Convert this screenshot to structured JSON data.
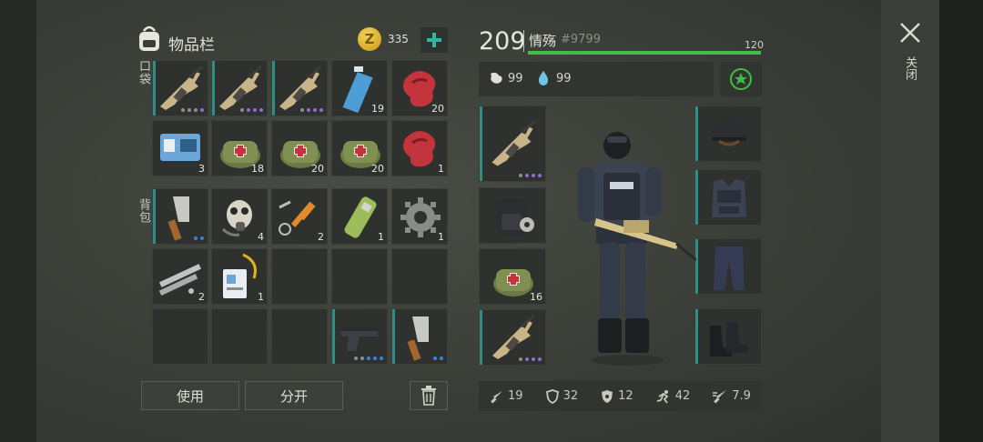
{
  "inventory": {
    "title": "物品栏",
    "coins": "335",
    "pocket_label": "口袋",
    "backpack_label": "背包",
    "slots": [
      {
        "icon": "rifle-icon",
        "count": "",
        "dots": "gggp"
      },
      {
        "icon": "rifle-icon",
        "count": "",
        "dots": "gppp"
      },
      {
        "icon": "rifle-icon",
        "count": "",
        "dots": "gppp"
      },
      {
        "icon": "water-bottle-icon",
        "count": "19",
        "dots": ""
      },
      {
        "icon": "raw-meat-icon",
        "count": "20",
        "dots": ""
      },
      {
        "icon": "keycard-icon",
        "count": "3",
        "dots": ""
      },
      {
        "icon": "medkit-bag-icon",
        "count": "18",
        "dots": ""
      },
      {
        "icon": "medkit-bag-icon",
        "count": "20",
        "dots": ""
      },
      {
        "icon": "medkit-bag-icon",
        "count": "20",
        "dots": ""
      },
      {
        "icon": "raw-meat-icon",
        "count": "1",
        "dots": ""
      },
      {
        "icon": "cleaver-icon",
        "count": "",
        "dots": "bb"
      },
      {
        "icon": "gas-mask-icon",
        "count": "4",
        "dots": ""
      },
      {
        "icon": "weapon-parts-icon",
        "count": "2",
        "dots": ""
      },
      {
        "icon": "battery-canister-icon",
        "count": "1",
        "dots": ""
      },
      {
        "icon": "gear-icon",
        "count": "1",
        "dots": ""
      },
      {
        "icon": "metal-pipes-icon",
        "count": "2",
        "dots": ""
      },
      {
        "icon": "id-badge-icon",
        "count": "1",
        "dots": ""
      },
      {
        "icon": "",
        "count": "",
        "dots": ""
      },
      {
        "icon": "",
        "count": "",
        "dots": ""
      },
      {
        "icon": "",
        "count": "",
        "dots": ""
      },
      {
        "icon": "",
        "count": "",
        "dots": ""
      },
      {
        "icon": "",
        "count": "",
        "dots": ""
      },
      {
        "icon": "",
        "count": "",
        "dots": ""
      },
      {
        "icon": "pistol-icon",
        "count": "",
        "dots": "ggbbb"
      },
      {
        "icon": "cleaver-icon",
        "count": "",
        "dots": "bb"
      }
    ],
    "use_button": "使用",
    "split_button": "分开"
  },
  "character": {
    "level": "209",
    "name": "情殇",
    "tag": "#9799",
    "xp_max": "120",
    "xp_fraction": 1.0,
    "food": "99",
    "water": "99",
    "equipment": [
      {
        "icon": "rifle-icon",
        "count": "",
        "dots": "gppp"
      },
      {
        "icon": "backpack-icon",
        "count": "",
        "dots": ""
      },
      {
        "icon": "medkit-bag-icon",
        "count": "16",
        "dots": ""
      },
      {
        "icon": "rifle-icon",
        "count": "",
        "dots": "gppp"
      }
    ],
    "armor": [
      "helmet-icon",
      "vest-icon",
      "pants-icon",
      "boots-icon"
    ],
    "stats": {
      "attack": "19",
      "defense": "32",
      "radiation": "12",
      "speed": "42",
      "crit": "7.9"
    }
  },
  "window": {
    "close_label": "关闭"
  }
}
